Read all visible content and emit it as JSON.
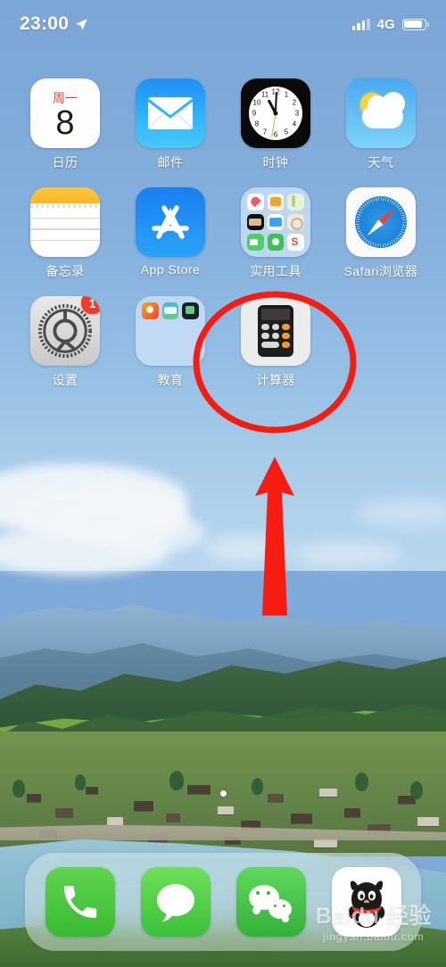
{
  "status_bar": {
    "time": "23:00",
    "location_icon": "location-arrow-icon",
    "signal_icon": "signal-bars-icon",
    "network": "4G",
    "battery_icon": "battery-full-icon"
  },
  "home_screen": {
    "rows": [
      [
        {
          "name": "calendar",
          "label": "日历",
          "icon": "calendar-icon",
          "day_of_week": "周一",
          "day": "8"
        },
        {
          "name": "mail",
          "label": "邮件",
          "icon": "mail-icon"
        },
        {
          "name": "clock",
          "label": "时钟",
          "icon": "clock-icon"
        },
        {
          "name": "weather",
          "label": "天气",
          "icon": "weather-icon"
        }
      ],
      [
        {
          "name": "notes",
          "label": "备忘录",
          "icon": "notes-icon"
        },
        {
          "name": "app-store",
          "label": "App Store",
          "icon": "app-store-icon"
        },
        {
          "name": "utilities-folder",
          "label": "实用工具",
          "icon": "folder-icon"
        },
        {
          "name": "safari",
          "label": "Safari浏览器",
          "icon": "safari-icon"
        }
      ],
      [
        {
          "name": "settings",
          "label": "设置",
          "icon": "settings-gear-icon",
          "badge": "1"
        },
        {
          "name": "education-folder",
          "label": "教育",
          "icon": "folder-icon"
        },
        {
          "name": "calculator",
          "label": "计算器",
          "icon": "calculator-icon"
        },
        {
          "name": "empty-slot",
          "label": "",
          "icon": ""
        }
      ]
    ],
    "page_indicator": {
      "pages": 1,
      "current": 1
    }
  },
  "dock": {
    "items": [
      {
        "name": "phone",
        "icon": "phone-handset-icon"
      },
      {
        "name": "messages",
        "icon": "speech-bubble-icon"
      },
      {
        "name": "wechat",
        "icon": "wechat-bubbles-icon"
      },
      {
        "name": "qq",
        "icon": "qq-penguin-icon"
      }
    ]
  },
  "annotation": {
    "highlight_shape": "red-ellipse",
    "highlight_target": "计算器",
    "arrow": "red-up-arrow",
    "color": "#f51d12"
  },
  "watermark": {
    "main": "Baidu 经验",
    "sub": "jingyan.baidu.com"
  }
}
